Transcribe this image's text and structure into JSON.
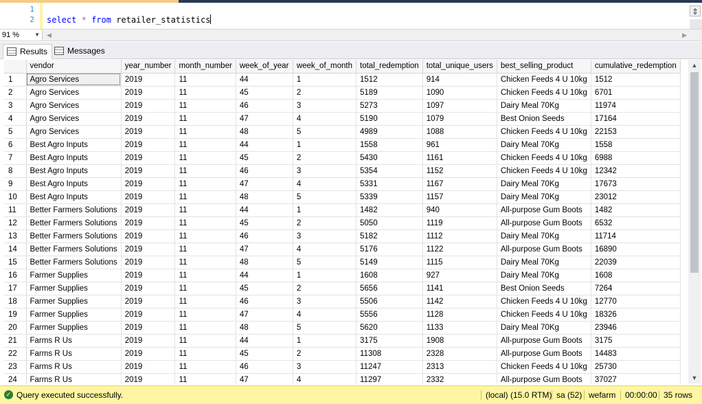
{
  "editor": {
    "line_numbers": [
      "1",
      "2"
    ],
    "kw_select": "select",
    "op_star": "*",
    "kw_from": "from",
    "table_name": "retailer_statistics"
  },
  "zoom": "91 %",
  "tabs": {
    "results": "Results",
    "messages": "Messages"
  },
  "columns": [
    "",
    "vendor",
    "year_number",
    "month_number",
    "week_of_year",
    "week_of_month",
    "total_redemption",
    "total_unique_users",
    "best_selling_product",
    "cumulative_redemption"
  ],
  "rows": [
    [
      "1",
      "Agro Services",
      "2019",
      "11",
      "44",
      "1",
      "1512",
      "914",
      "Chicken Feeds 4 U 10kg",
      "1512"
    ],
    [
      "2",
      "Agro Services",
      "2019",
      "11",
      "45",
      "2",
      "5189",
      "1090",
      "Chicken Feeds 4 U 10kg",
      "6701"
    ],
    [
      "3",
      "Agro Services",
      "2019",
      "11",
      "46",
      "3",
      "5273",
      "1097",
      "Dairy Meal 70Kg",
      "11974"
    ],
    [
      "4",
      "Agro Services",
      "2019",
      "11",
      "47",
      "4",
      "5190",
      "1079",
      "Best Onion Seeds",
      "17164"
    ],
    [
      "5",
      "Agro Services",
      "2019",
      "11",
      "48",
      "5",
      "4989",
      "1088",
      "Chicken Feeds 4 U 10kg",
      "22153"
    ],
    [
      "6",
      "Best Agro Inputs",
      "2019",
      "11",
      "44",
      "1",
      "1558",
      "961",
      "Dairy Meal 70Kg",
      "1558"
    ],
    [
      "7",
      "Best Agro Inputs",
      "2019",
      "11",
      "45",
      "2",
      "5430",
      "1161",
      "Chicken Feeds 4 U 10kg",
      "6988"
    ],
    [
      "8",
      "Best Agro Inputs",
      "2019",
      "11",
      "46",
      "3",
      "5354",
      "1152",
      "Chicken Feeds 4 U 10kg",
      "12342"
    ],
    [
      "9",
      "Best Agro Inputs",
      "2019",
      "11",
      "47",
      "4",
      "5331",
      "1167",
      "Dairy Meal 70Kg",
      "17673"
    ],
    [
      "10",
      "Best Agro Inputs",
      "2019",
      "11",
      "48",
      "5",
      "5339",
      "1157",
      "Dairy Meal 70Kg",
      "23012"
    ],
    [
      "11",
      "Better Farmers Solutions",
      "2019",
      "11",
      "44",
      "1",
      "1482",
      "940",
      "All-purpose Gum Boots",
      "1482"
    ],
    [
      "12",
      "Better Farmers Solutions",
      "2019",
      "11",
      "45",
      "2",
      "5050",
      "1119",
      "All-purpose Gum Boots",
      "6532"
    ],
    [
      "13",
      "Better Farmers Solutions",
      "2019",
      "11",
      "46",
      "3",
      "5182",
      "1112",
      "Dairy Meal 70Kg",
      "11714"
    ],
    [
      "14",
      "Better Farmers Solutions",
      "2019",
      "11",
      "47",
      "4",
      "5176",
      "1122",
      "All-purpose Gum Boots",
      "16890"
    ],
    [
      "15",
      "Better Farmers Solutions",
      "2019",
      "11",
      "48",
      "5",
      "5149",
      "1115",
      "Dairy Meal 70Kg",
      "22039"
    ],
    [
      "16",
      "Farmer Supplies",
      "2019",
      "11",
      "44",
      "1",
      "1608",
      "927",
      "Dairy Meal 70Kg",
      "1608"
    ],
    [
      "17",
      "Farmer Supplies",
      "2019",
      "11",
      "45",
      "2",
      "5656",
      "1141",
      "Best Onion Seeds",
      "7264"
    ],
    [
      "18",
      "Farmer Supplies",
      "2019",
      "11",
      "46",
      "3",
      "5506",
      "1142",
      "Chicken Feeds 4 U 10kg",
      "12770"
    ],
    [
      "19",
      "Farmer Supplies",
      "2019",
      "11",
      "47",
      "4",
      "5556",
      "1128",
      "Chicken Feeds 4 U 10kg",
      "18326"
    ],
    [
      "20",
      "Farmer Supplies",
      "2019",
      "11",
      "48",
      "5",
      "5620",
      "1133",
      "Dairy Meal 70Kg",
      "23946"
    ],
    [
      "21",
      "Farms R Us",
      "2019",
      "11",
      "44",
      "1",
      "3175",
      "1908",
      "All-purpose Gum Boots",
      "3175"
    ],
    [
      "22",
      "Farms R Us",
      "2019",
      "11",
      "45",
      "2",
      "11308",
      "2328",
      "All-purpose Gum Boots",
      "14483"
    ],
    [
      "23",
      "Farms R Us",
      "2019",
      "11",
      "46",
      "3",
      "11247",
      "2313",
      "Chicken Feeds 4 U 10kg",
      "25730"
    ],
    [
      "24",
      "Farms R Us",
      "2019",
      "11",
      "47",
      "4",
      "11297",
      "2332",
      "All-purpose Gum Boots",
      "37027"
    ]
  ],
  "status": {
    "message": "Query executed successfully.",
    "server": "(local) (15.0 RTM)",
    "user": "sa (52)",
    "database": "wefarm",
    "elapsed": "00:00:00",
    "rowcount": "35 rows"
  },
  "colors": {
    "status_bg": "#fff6a3",
    "keyword": "#0000ff",
    "line_number": "#2b91af"
  }
}
